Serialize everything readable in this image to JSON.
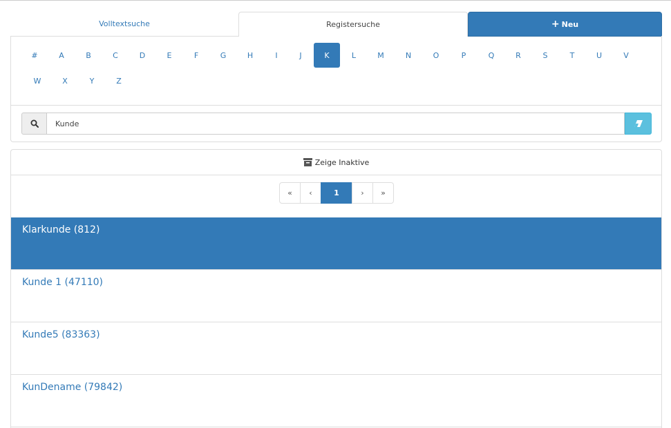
{
  "tabs": {
    "volltext": "Volltextsuche",
    "register": "Registersuche",
    "neu": "Neu"
  },
  "letters": {
    "hash": "#",
    "a": "A",
    "b": "B",
    "c": "C",
    "d": "D",
    "e": "E",
    "f": "F",
    "g": "G",
    "h": "H",
    "i": "I",
    "j": "J",
    "k": "K",
    "l": "L",
    "m": "M",
    "n": "N",
    "o": "O",
    "p": "P",
    "q": "Q",
    "r": "R",
    "s": "S",
    "t": "T",
    "u": "U",
    "v": "V",
    "w": "W",
    "x": "X",
    "y": "Y",
    "z": "Z"
  },
  "active_letter": "K",
  "search": {
    "value": "Kunde"
  },
  "inactive_label": "Zeige Inaktive",
  "pagination": {
    "first": "«",
    "prev": "‹",
    "current": "1",
    "next": "›",
    "last": "»"
  },
  "results": [
    {
      "label": "Klarkunde (812)",
      "selected": true
    },
    {
      "label": "Kunde 1 (47110)",
      "selected": false
    },
    {
      "label": "Kunde5 (83363)",
      "selected": false
    },
    {
      "label": "KunDename (79842)",
      "selected": false
    }
  ],
  "colors": {
    "primary": "#337ab7",
    "info": "#5bc0de",
    "border": "#dddddd"
  }
}
